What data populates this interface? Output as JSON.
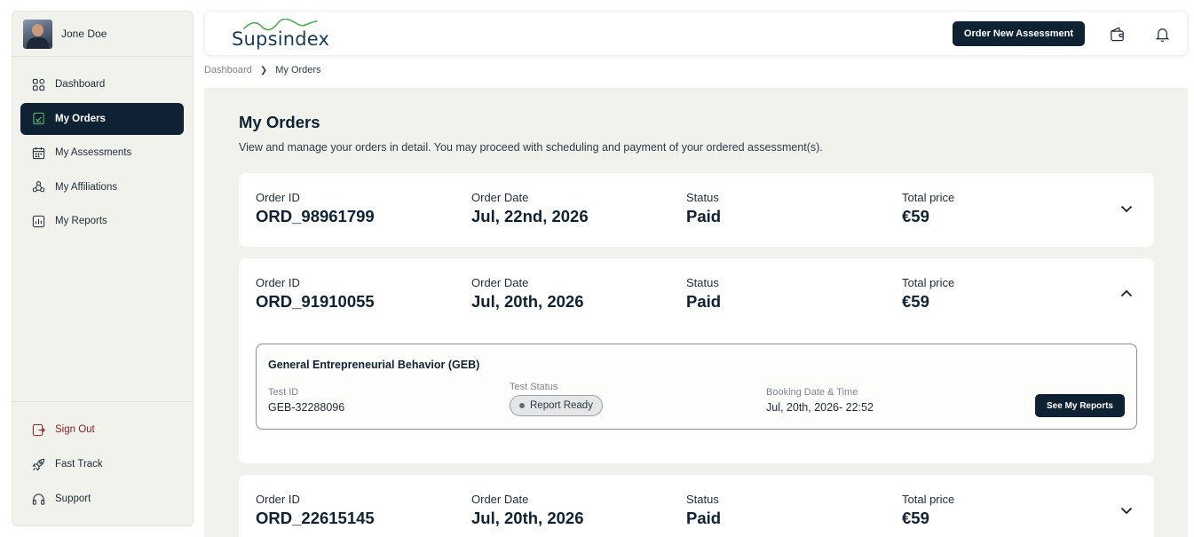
{
  "user": {
    "name": "Jone Doe"
  },
  "sidebar": {
    "items": [
      {
        "label": "Dashboard",
        "icon": "dashboard-icon"
      },
      {
        "label": "My Orders",
        "icon": "orders-icon",
        "active": true
      },
      {
        "label": "My Assessments",
        "icon": "calendar-icon"
      },
      {
        "label": "My Affiliations",
        "icon": "affiliations-icon"
      },
      {
        "label": "My Reports",
        "icon": "reports-icon"
      }
    ],
    "bottom": [
      {
        "label": "Sign Out",
        "icon": "sign-out-icon"
      },
      {
        "label": "Fast Track",
        "icon": "rocket-icon"
      },
      {
        "label": "Support",
        "icon": "headset-icon"
      }
    ]
  },
  "header": {
    "logo": "Supsindex",
    "order_button": "Order New Assessment",
    "icons": [
      "wallet-icon",
      "bell-icon"
    ]
  },
  "breadcrumb": {
    "root": "Dashboard",
    "current": "My Orders"
  },
  "page": {
    "title": "My Orders",
    "description": "View and manage your orders in detail. You may proceed with scheduling and payment of your ordered assessment(s)."
  },
  "labels": {
    "order_id": "Order ID",
    "order_date": "Order Date",
    "status": "Status",
    "total_price": "Total price",
    "test_id": "Test ID",
    "test_status": "Test Status",
    "booking": "Booking Date & Time"
  },
  "orders": [
    {
      "id": "ORD_98961799",
      "date": "Jul, 22nd, 2026",
      "status": "Paid",
      "price": "€59",
      "expanded": false
    },
    {
      "id": "ORD_91910055",
      "date": "Jul, 20th, 2026",
      "status": "Paid",
      "price": "€59",
      "expanded": true,
      "test": {
        "name": "General Entrepreneurial Behavior (GEB)",
        "test_id": "GEB-32288096",
        "status": "Report Ready",
        "booking": "Jul, 20th, 2026- 22:52",
        "button": "See My Reports"
      }
    },
    {
      "id": "ORD_22615145",
      "date": "Jul, 20th, 2026",
      "status": "Paid",
      "price": "€59",
      "expanded": false
    }
  ],
  "colors": {
    "primary": "#0f2233",
    "background": "#f1f2ec",
    "signout": "#8a2020",
    "logo_accent": "#4caf50"
  }
}
